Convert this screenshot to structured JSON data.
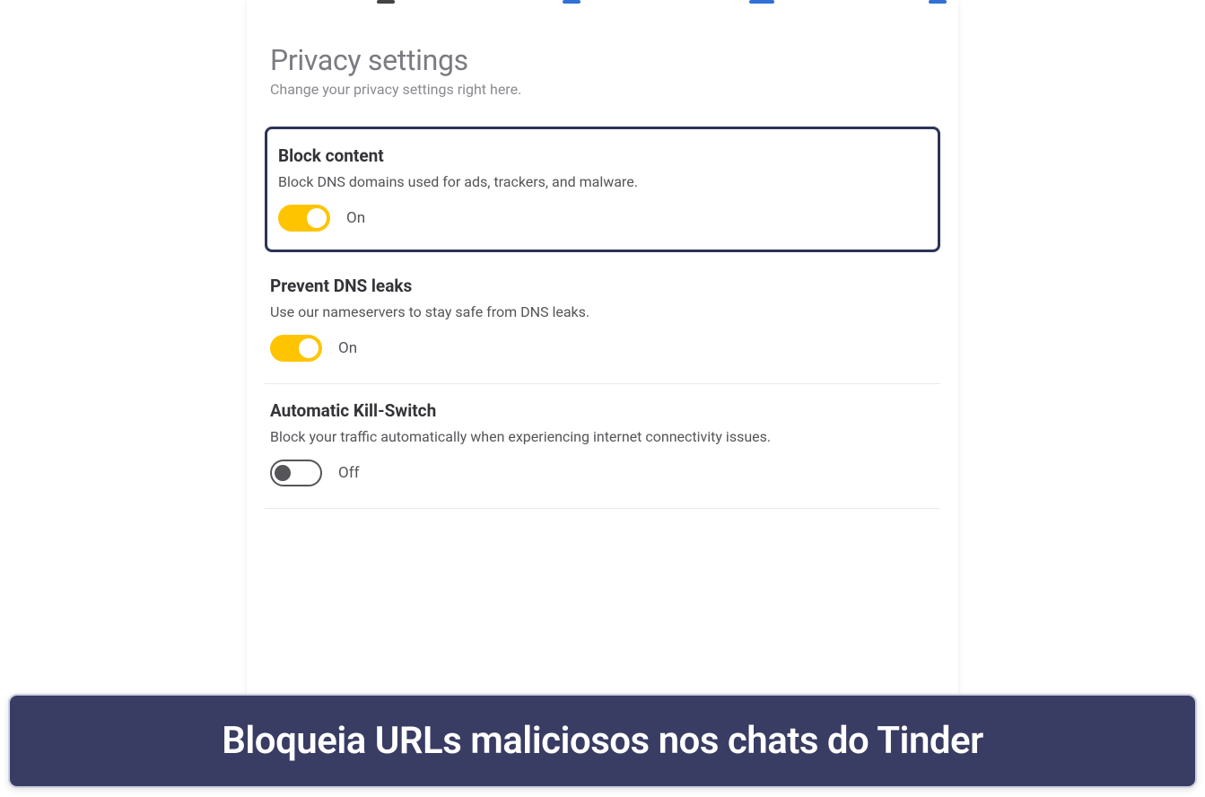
{
  "header": {
    "title": "Privacy settings",
    "subtitle": "Change your privacy settings right here."
  },
  "settings": {
    "block_content": {
      "title": "Block content",
      "desc": "Block DNS domains used for ads, trackers, and malware.",
      "state_label": "On",
      "enabled": true
    },
    "prevent_dns_leaks": {
      "title": "Prevent DNS leaks",
      "desc": "Use our nameservers to stay safe from DNS leaks.",
      "state_label": "On",
      "enabled": true
    },
    "kill_switch": {
      "title": "Automatic Kill-Switch",
      "desc": "Block your traffic automatically when experiencing internet connectivity issues.",
      "state_label": "Off",
      "enabled": false
    }
  },
  "caption": {
    "text": "Bloqueia URLs maliciosos nos chats do Tinder"
  }
}
